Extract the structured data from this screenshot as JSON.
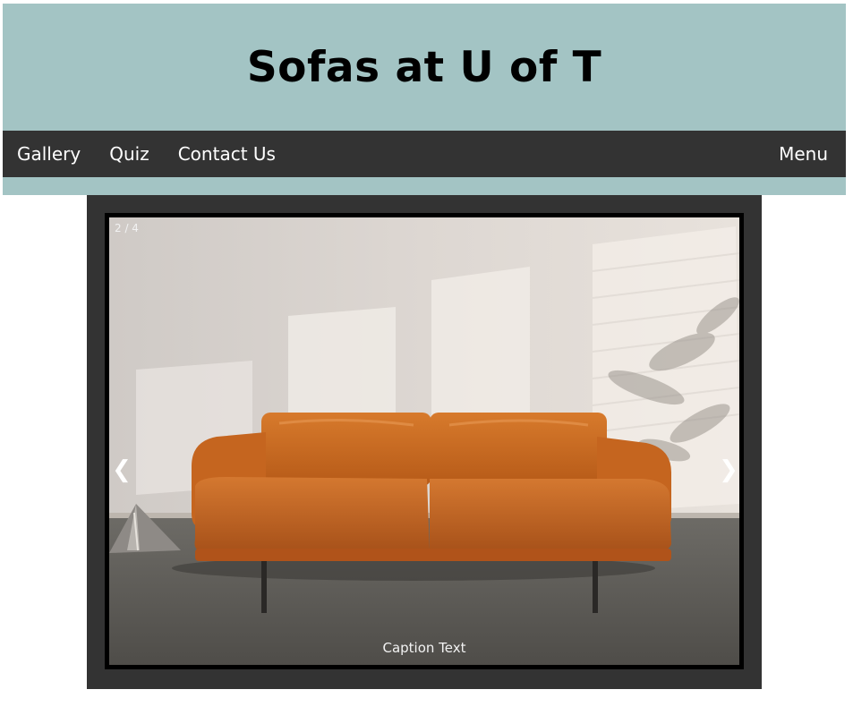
{
  "header": {
    "title": "Sofas at U of T"
  },
  "nav": {
    "items": [
      {
        "label": "Gallery"
      },
      {
        "label": "Quiz"
      },
      {
        "label": "Contact Us"
      }
    ],
    "menu_label": "Menu"
  },
  "slideshow": {
    "counter": "2 / 4",
    "caption": "Caption Text",
    "prev_arrow": "❮",
    "next_arrow": "❯"
  },
  "colors": {
    "header_bg": "#a3c4c4",
    "nav_bg": "#333333",
    "sofa": "#c8641e"
  }
}
